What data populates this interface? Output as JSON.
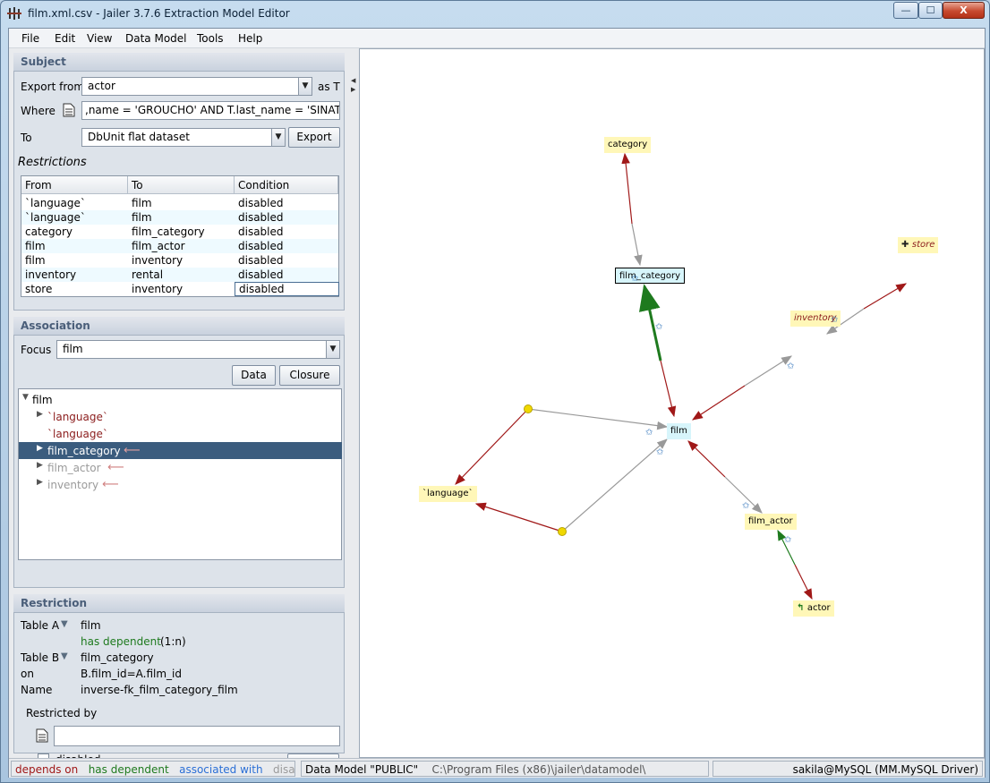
{
  "window": {
    "title": "film.xml.csv - Jailer 3.7.6 Extraction Model Editor",
    "min_symbol": "—",
    "max_symbol": "☐",
    "close_symbol": "X"
  },
  "menubar": [
    "File",
    "Edit",
    "View",
    "Data Model",
    "Tools",
    "Help"
  ],
  "subject": {
    "header": "Subject",
    "export_from_label": "Export from",
    "export_from_value": "actor",
    "as_label": "as T",
    "where_label": "Where",
    "where_value": ",name = 'GROUCHO' AND T.last_name = 'SINATRA'",
    "to_label": "To",
    "to_value": "DbUnit flat dataset",
    "export_button": "Export"
  },
  "restrictions": {
    "header": "Restrictions",
    "columns": [
      "From",
      "To",
      "Condition"
    ],
    "rows": [
      [
        "`language`",
        "film",
        "disabled"
      ],
      [
        "`language`",
        "film",
        "disabled"
      ],
      [
        "category",
        "film_category",
        "disabled"
      ],
      [
        "film",
        "film_actor",
        "disabled"
      ],
      [
        "film",
        "inventory",
        "disabled"
      ],
      [
        "inventory",
        "rental",
        "disabled"
      ],
      [
        "store",
        "inventory",
        "disabled"
      ]
    ]
  },
  "association": {
    "header": "Association",
    "focus_label": "Focus",
    "focus_value": "film",
    "data_button": "Data",
    "closure_button": "Closure",
    "tree": {
      "root": "film",
      "items": [
        {
          "label": "`language`",
          "color": "#8b1c1c",
          "expandable": true,
          "back_arrow": false
        },
        {
          "label": "`language`",
          "color": "#8b1c1c",
          "expandable": false,
          "back_arrow": false
        },
        {
          "label": "film_category",
          "color": "#ffffff",
          "expandable": true,
          "back_arrow": true,
          "selected": true
        },
        {
          "label": "film_actor",
          "color": "#9a9a9a",
          "expandable": true,
          "back_arrow": true
        },
        {
          "label": "inventory",
          "color": "#9a9a9a",
          "expandable": true,
          "back_arrow": true
        }
      ]
    }
  },
  "restriction_detail": {
    "header": "Restriction",
    "table_a_label": "Table A",
    "table_a_value": "film",
    "relation": "has dependent",
    "cardinality": "(1:n)",
    "table_b_label": "Table B",
    "table_b_value": "film_category",
    "on_label": "on",
    "on_value": "B.film_id=A.film_id",
    "name_label": "Name",
    "name_value": "inverse-fk_film_category_film",
    "restricted_by_label": "Restricted by",
    "restricted_by_value": "",
    "disabled_label": "disabled",
    "apply_button": "apply"
  },
  "graph": {
    "nodes": {
      "category": "category",
      "film_category": "film_category",
      "store": "store",
      "inventory": "inventory",
      "film": "film",
      "language": "`language`",
      "film_actor": "film_actor",
      "actor": "actor"
    }
  },
  "statusbar": {
    "depends_on": "depends on",
    "has_dependent": "has dependent",
    "associated_with": "associated with",
    "disabled": "disabled",
    "data_model": "Data Model \"PUBLIC\"",
    "path": "C:\\Program Files (x86)\\jailer\\datamodel\\",
    "connection": "sakila@MySQL (MM.MySQL Driver)"
  },
  "colors": {
    "depends_on": "#a01818",
    "has_dependent": "#1e7a1e",
    "associated_with": "#2b6fd6",
    "disabled": "#9a9a9a",
    "selection": "#3b5c7e",
    "node_fill": "#fff7b8",
    "focus_fill": "#d7f5fb"
  },
  "icons": {
    "app": "jailer-app-icon",
    "where_editor": "document-icon",
    "restricted_by_editor": "document-icon",
    "back_arrow": "left-arrow-icon"
  }
}
